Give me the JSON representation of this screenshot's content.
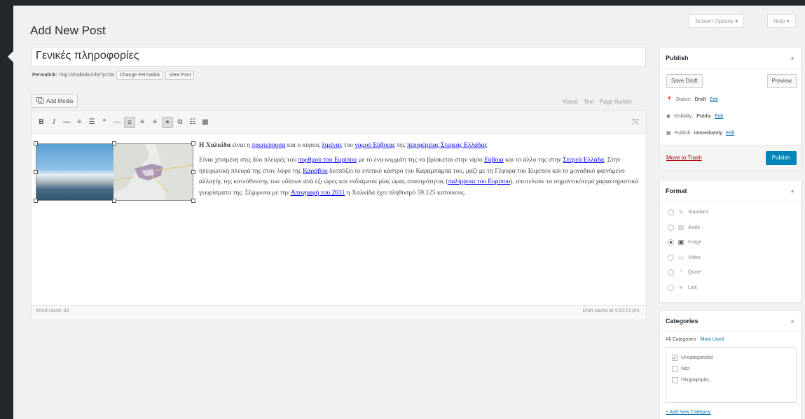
{
  "header": {
    "page_title": "Add New Post",
    "screen_options": "Screen Options ▾",
    "help": "Help ▾"
  },
  "post": {
    "title": "Γενικές πληροφορίες",
    "permalink_label": "Permalink:",
    "permalink_url": "http://chalkida.info/?p=59",
    "change_permalink": "Change Permalink",
    "view_post": "View Post"
  },
  "editor": {
    "add_media": "Add Media",
    "tabs": [
      "Visual",
      "Text",
      "Page Builder"
    ],
    "toolbar_icons": [
      "bold-icon",
      "italic-icon",
      "strikethrough-icon",
      "bullet-list-icon",
      "numbered-list-icon",
      "blockquote-icon",
      "horizontal-line-icon",
      "align-left-icon",
      "align-center-icon",
      "align-right-icon",
      "insert-link-icon",
      "remove-link-icon",
      "read-more-icon",
      "toolbar-toggle-icon"
    ],
    "content": {
      "p1": {
        "bold": "Η Χαλκίδα",
        "t1": " είναι η ",
        "l1": "πρωτεύουσα",
        "t2": " και ο κύριος ",
        "l2": "λιμένας",
        "t3": " του ",
        "l3": "νομού Εύβοιας",
        "t4": " της ",
        "l4": "περιφέρειας Στερεάς Ελλάδας"
      },
      "p2": {
        "t1": "Είναι χτισμένη στις δύο πλευρές του ",
        "l1": "πορθμού του Ευρίπου",
        "t2": " με το ένα κομμάτι της να βρίσκεται στην νήσο ",
        "l2": "Εύβοια",
        "t3": " και το άλλο της στην ",
        "l3": "Στερεά Ελλάδα",
        "t4": ". Στην ηπειρωτική πλευρά της στον λόφο της ",
        "l4": "Καράβου",
        "t5": " δεσπόζει το ενετικό κάστρο του Καραμπαμπά του, μαζί με τη Γέφυρα του Ευρίπου και το μοναδικό φαινόμενο αλλαγής της κατεύθυνσης των υδάτων ανά έξι ώρες και ενδιάμεσα μίας ώρας στασιμότητας (",
        "l5": "παλίρροια του Ευρίπου",
        "t6": "), αποτελούν τα σημαντικότερα χαρακτηριστικά γνωρίσματα της. Σύμφωνα με την ",
        "l6": "Απογραφή του 2011",
        "t7": " η Χαλκίδα έχει πληθυσμό 59.125 κατοίκους."
      }
    },
    "word_count": "Word count: 88",
    "draft_saved": "Draft saved at 4:53:15 pm."
  },
  "publish": {
    "title": "Publish",
    "save_draft": "Save Draft",
    "preview": "Preview",
    "status_label": "Status:",
    "status_value": "Draft",
    "visibility_label": "Visibility:",
    "visibility_value": "Public",
    "publish_label": "Publish",
    "publish_value": "immediately",
    "edit": "Edit",
    "move_to_trash": "Move to Trash",
    "publish_button": "Publish",
    "accent_color": "#0085ba"
  },
  "format": {
    "title": "Format",
    "options": [
      {
        "label": "Standard",
        "icon": "pin-icon",
        "checked": false
      },
      {
        "label": "Aside",
        "icon": "aside-icon",
        "checked": false
      },
      {
        "label": "Image",
        "icon": "image-icon",
        "checked": true
      },
      {
        "label": "Video",
        "icon": "video-icon",
        "checked": false
      },
      {
        "label": "Quote",
        "icon": "quote-icon",
        "checked": false
      },
      {
        "label": "Link",
        "icon": "link-icon",
        "checked": false
      }
    ]
  },
  "categories": {
    "title": "Categories",
    "tab_all": "All Categories",
    "tab_most_used": "Most Used",
    "items": [
      {
        "label": "Uncategorized",
        "checked": true
      },
      {
        "label": "Νέα",
        "checked": false
      },
      {
        "label": "Πληροφορίες",
        "checked": false
      }
    ],
    "add_new": "+ Add New Category"
  }
}
